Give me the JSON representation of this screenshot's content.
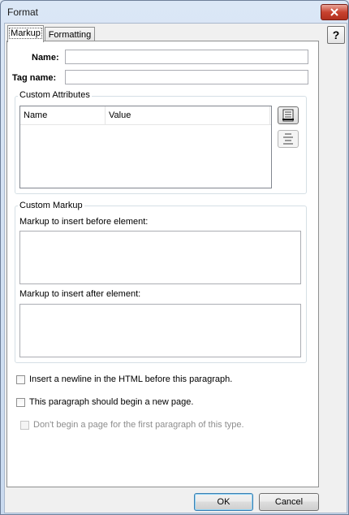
{
  "window": {
    "title": "Format"
  },
  "help": {
    "label": "?"
  },
  "tabs": [
    {
      "label": "Markup"
    },
    {
      "label": "Formatting"
    }
  ],
  "fields": {
    "name_label": "Name:",
    "name_value": "",
    "tag_label": "Tag name:",
    "tag_value": ""
  },
  "custom_attributes": {
    "title": "Custom Attributes",
    "columns": [
      "Name",
      "Value"
    ],
    "rows": [],
    "add_icon": "list-add-icon",
    "remove_icon": "list-remove-icon"
  },
  "custom_markup": {
    "title": "Custom Markup",
    "before_label": "Markup to insert before element:",
    "before_value": "",
    "after_label": "Markup to insert after element:",
    "after_value": ""
  },
  "options": [
    {
      "label": "Insert a newline in the HTML before this paragraph.",
      "checked": false,
      "enabled": true
    },
    {
      "label": "This paragraph should begin a new page.",
      "checked": false,
      "enabled": true
    },
    {
      "label": "Don't begin a page for the first paragraph of this type.",
      "checked": false,
      "enabled": false
    }
  ],
  "buttons": {
    "ok": "OK",
    "cancel": "Cancel"
  }
}
